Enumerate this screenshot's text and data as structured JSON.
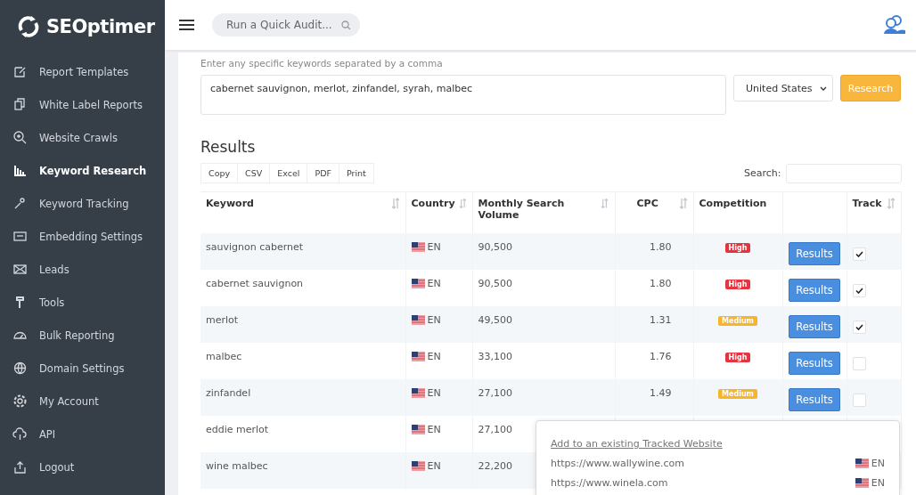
{
  "brand": {
    "name": "SEOptimer"
  },
  "sidebar": {
    "items": [
      {
        "label": "Report Templates",
        "selected": false
      },
      {
        "label": "White Label Reports",
        "selected": false
      },
      {
        "label": "Website Crawls",
        "selected": false
      },
      {
        "label": "Keyword Research",
        "selected": true
      },
      {
        "label": "Keyword Tracking",
        "selected": false
      },
      {
        "label": "Embedding Settings",
        "selected": false
      },
      {
        "label": "Leads",
        "selected": false
      },
      {
        "label": "Tools",
        "selected": false
      },
      {
        "label": "Bulk Reporting",
        "selected": false
      },
      {
        "label": "Domain Settings",
        "selected": false
      },
      {
        "label": "My Account",
        "selected": false
      },
      {
        "label": "API",
        "selected": false
      },
      {
        "label": "Logout",
        "selected": false
      }
    ]
  },
  "header": {
    "search": {
      "placeholder": "Run a Quick Audit..."
    }
  },
  "keywords": {
    "hint": "Enter any specific keywords separated by a comma",
    "value": "cabernet sauvignon, merlot, zinfandel, syrah, malbec",
    "country": "United States",
    "button": "Research"
  },
  "results": {
    "title": "Results",
    "export_buttons": [
      "Copy",
      "CSV",
      "Excel",
      "PDF",
      "Print"
    ],
    "search_label": "Search:",
    "table": {
      "columns": [
        "Keyword",
        "Country",
        "Monthly Search Volume",
        "CPC",
        "Competition",
        "Track"
      ],
      "rows": [
        {
          "keyword": "sauvignon cabernet",
          "country": "EN",
          "volume": "90,500",
          "cpc": "1.80",
          "competition": {
            "label": "High",
            "kind": "high"
          },
          "button": "Results",
          "track": true
        },
        {
          "keyword": "cabernet sauvignon",
          "country": "EN",
          "volume": "90,500",
          "cpc": "1.80",
          "competition": {
            "label": "High",
            "kind": "high"
          },
          "button": "Results",
          "track": true
        },
        {
          "keyword": "merlot",
          "country": "EN",
          "volume": "49,500",
          "cpc": "1.31",
          "competition": {
            "label": "Medium",
            "kind": "medium"
          },
          "button": "Results",
          "track": true
        },
        {
          "keyword": "malbec",
          "country": "EN",
          "volume": "33,100",
          "cpc": "1.76",
          "competition": {
            "label": "High",
            "kind": "high"
          },
          "button": "Results",
          "track": false
        },
        {
          "keyword": "zinfandel",
          "country": "EN",
          "volume": "27,100",
          "cpc": "1.49",
          "competition": {
            "label": "Medium",
            "kind": "medium"
          },
          "button": "Results",
          "track": false
        },
        {
          "keyword": "eddie merlot",
          "country": "EN",
          "volume": "27,100"
        },
        {
          "keyword": "wine malbec",
          "country": "EN",
          "volume": "22,200"
        }
      ]
    }
  },
  "track_popup": {
    "title": "Add to an existing Tracked Website",
    "sites": [
      {
        "url": "https://www.wallywine.com",
        "country": "EN"
      },
      {
        "url": "https://www.winela.com",
        "country": "EN"
      }
    ]
  }
}
